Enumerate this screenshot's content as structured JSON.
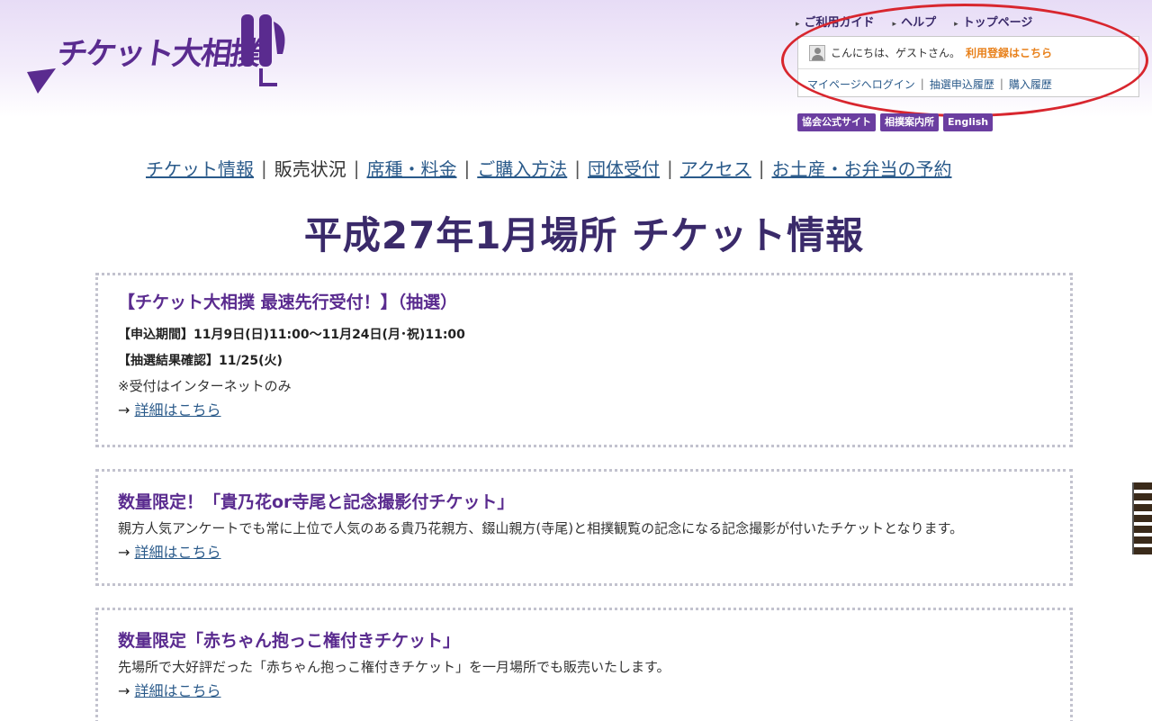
{
  "logo": {
    "text": "チケット大相撲",
    "mark_icon": "sumo-logo-icon"
  },
  "utility": {
    "guide": "ご利用ガイド",
    "help": "ヘルプ",
    "top": "トップページ"
  },
  "guest": {
    "greeting": "こんにちは、ゲストさん。",
    "register": "利用登録はこちら",
    "login": "マイページへログイン",
    "lottery_history": "抽選申込履歴",
    "purchase_history": "購入履歴",
    "separator": "|"
  },
  "badges": {
    "official": "協会公式サイト",
    "guide": "相撲案内所",
    "english": "English"
  },
  "nav": {
    "ticket_info": "チケット情報",
    "sales_status": "販売状況",
    "seats": "席種・料金",
    "purchase": "ご購入方法",
    "group": "団体受付",
    "access": "アクセス",
    "souvenir": "お土産・お弁当の予約",
    "bar": "|"
  },
  "page_title": "平成27年1月場所 チケット情報",
  "boxes": {
    "b1": {
      "title": "【チケット大相撲 最速先行受付！】（抽選）",
      "period": "【申込期間】11月9日(日)11:00～11月24日(月･祝)11:00",
      "result": "【抽選結果確認】11/25(火)",
      "note": "※受付はインターネットのみ",
      "arrow": "→ ",
      "detail": "詳細はこちら"
    },
    "b2": {
      "title": "数量限定！「貴乃花or寺尾と記念撮影付チケット」",
      "desc": "親方人気アンケートでも常に上位で人気のある貴乃花親方、錣山親方(寺尾)と相撲観覧の記念になる記念撮影が付いたチケットとなります。",
      "arrow": "→ ",
      "detail": "詳細はこちら"
    },
    "b3": {
      "title": "数量限定「赤ちゃん抱っこ権付きチケット」",
      "desc": "先場所で大好評だった「赤ちゃん抱っこ権付きチケット」を一月場所でも販売いたします。",
      "arrow": "→ ",
      "detail": "詳細はこちら"
    }
  },
  "colors": {
    "brand": "#5a2b8f",
    "link": "#2a5a8a",
    "register": "#e8801a",
    "annotation": "#d8262e"
  }
}
